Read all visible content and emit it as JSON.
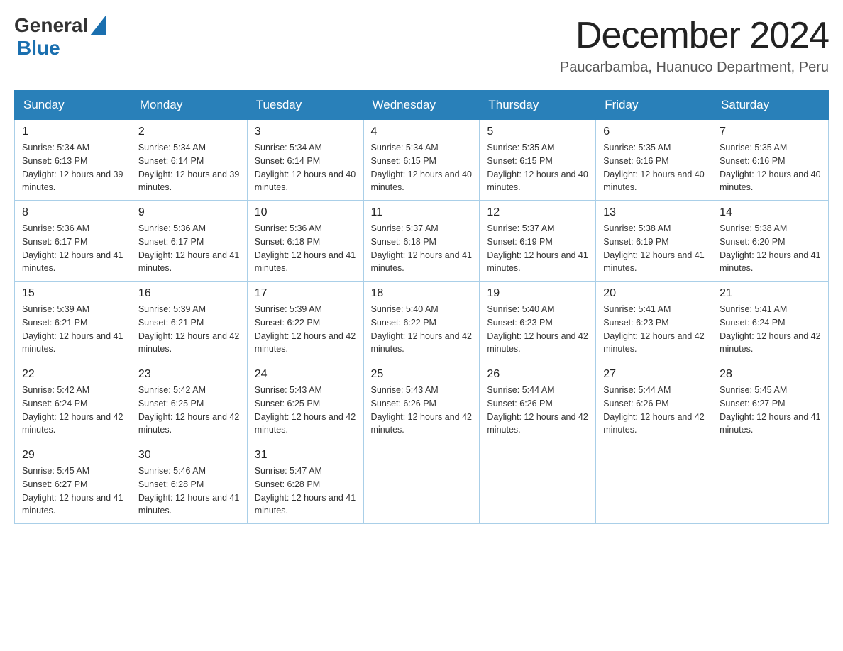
{
  "header": {
    "logo_general": "General",
    "logo_blue": "Blue",
    "month_title": "December 2024",
    "location": "Paucarbamba, Huanuco Department, Peru"
  },
  "weekdays": [
    "Sunday",
    "Monday",
    "Tuesday",
    "Wednesday",
    "Thursday",
    "Friday",
    "Saturday"
  ],
  "weeks": [
    [
      {
        "day": "1",
        "sunrise": "5:34 AM",
        "sunset": "6:13 PM",
        "daylight": "12 hours and 39 minutes."
      },
      {
        "day": "2",
        "sunrise": "5:34 AM",
        "sunset": "6:14 PM",
        "daylight": "12 hours and 39 minutes."
      },
      {
        "day": "3",
        "sunrise": "5:34 AM",
        "sunset": "6:14 PM",
        "daylight": "12 hours and 40 minutes."
      },
      {
        "day": "4",
        "sunrise": "5:34 AM",
        "sunset": "6:15 PM",
        "daylight": "12 hours and 40 minutes."
      },
      {
        "day": "5",
        "sunrise": "5:35 AM",
        "sunset": "6:15 PM",
        "daylight": "12 hours and 40 minutes."
      },
      {
        "day": "6",
        "sunrise": "5:35 AM",
        "sunset": "6:16 PM",
        "daylight": "12 hours and 40 minutes."
      },
      {
        "day": "7",
        "sunrise": "5:35 AM",
        "sunset": "6:16 PM",
        "daylight": "12 hours and 40 minutes."
      }
    ],
    [
      {
        "day": "8",
        "sunrise": "5:36 AM",
        "sunset": "6:17 PM",
        "daylight": "12 hours and 41 minutes."
      },
      {
        "day": "9",
        "sunrise": "5:36 AM",
        "sunset": "6:17 PM",
        "daylight": "12 hours and 41 minutes."
      },
      {
        "day": "10",
        "sunrise": "5:36 AM",
        "sunset": "6:18 PM",
        "daylight": "12 hours and 41 minutes."
      },
      {
        "day": "11",
        "sunrise": "5:37 AM",
        "sunset": "6:18 PM",
        "daylight": "12 hours and 41 minutes."
      },
      {
        "day": "12",
        "sunrise": "5:37 AM",
        "sunset": "6:19 PM",
        "daylight": "12 hours and 41 minutes."
      },
      {
        "day": "13",
        "sunrise": "5:38 AM",
        "sunset": "6:19 PM",
        "daylight": "12 hours and 41 minutes."
      },
      {
        "day": "14",
        "sunrise": "5:38 AM",
        "sunset": "6:20 PM",
        "daylight": "12 hours and 41 minutes."
      }
    ],
    [
      {
        "day": "15",
        "sunrise": "5:39 AM",
        "sunset": "6:21 PM",
        "daylight": "12 hours and 41 minutes."
      },
      {
        "day": "16",
        "sunrise": "5:39 AM",
        "sunset": "6:21 PM",
        "daylight": "12 hours and 42 minutes."
      },
      {
        "day": "17",
        "sunrise": "5:39 AM",
        "sunset": "6:22 PM",
        "daylight": "12 hours and 42 minutes."
      },
      {
        "day": "18",
        "sunrise": "5:40 AM",
        "sunset": "6:22 PM",
        "daylight": "12 hours and 42 minutes."
      },
      {
        "day": "19",
        "sunrise": "5:40 AM",
        "sunset": "6:23 PM",
        "daylight": "12 hours and 42 minutes."
      },
      {
        "day": "20",
        "sunrise": "5:41 AM",
        "sunset": "6:23 PM",
        "daylight": "12 hours and 42 minutes."
      },
      {
        "day": "21",
        "sunrise": "5:41 AM",
        "sunset": "6:24 PM",
        "daylight": "12 hours and 42 minutes."
      }
    ],
    [
      {
        "day": "22",
        "sunrise": "5:42 AM",
        "sunset": "6:24 PM",
        "daylight": "12 hours and 42 minutes."
      },
      {
        "day": "23",
        "sunrise": "5:42 AM",
        "sunset": "6:25 PM",
        "daylight": "12 hours and 42 minutes."
      },
      {
        "day": "24",
        "sunrise": "5:43 AM",
        "sunset": "6:25 PM",
        "daylight": "12 hours and 42 minutes."
      },
      {
        "day": "25",
        "sunrise": "5:43 AM",
        "sunset": "6:26 PM",
        "daylight": "12 hours and 42 minutes."
      },
      {
        "day": "26",
        "sunrise": "5:44 AM",
        "sunset": "6:26 PM",
        "daylight": "12 hours and 42 minutes."
      },
      {
        "day": "27",
        "sunrise": "5:44 AM",
        "sunset": "6:26 PM",
        "daylight": "12 hours and 42 minutes."
      },
      {
        "day": "28",
        "sunrise": "5:45 AM",
        "sunset": "6:27 PM",
        "daylight": "12 hours and 41 minutes."
      }
    ],
    [
      {
        "day": "29",
        "sunrise": "5:45 AM",
        "sunset": "6:27 PM",
        "daylight": "12 hours and 41 minutes."
      },
      {
        "day": "30",
        "sunrise": "5:46 AM",
        "sunset": "6:28 PM",
        "daylight": "12 hours and 41 minutes."
      },
      {
        "day": "31",
        "sunrise": "5:47 AM",
        "sunset": "6:28 PM",
        "daylight": "12 hours and 41 minutes."
      },
      null,
      null,
      null,
      null
    ]
  ]
}
